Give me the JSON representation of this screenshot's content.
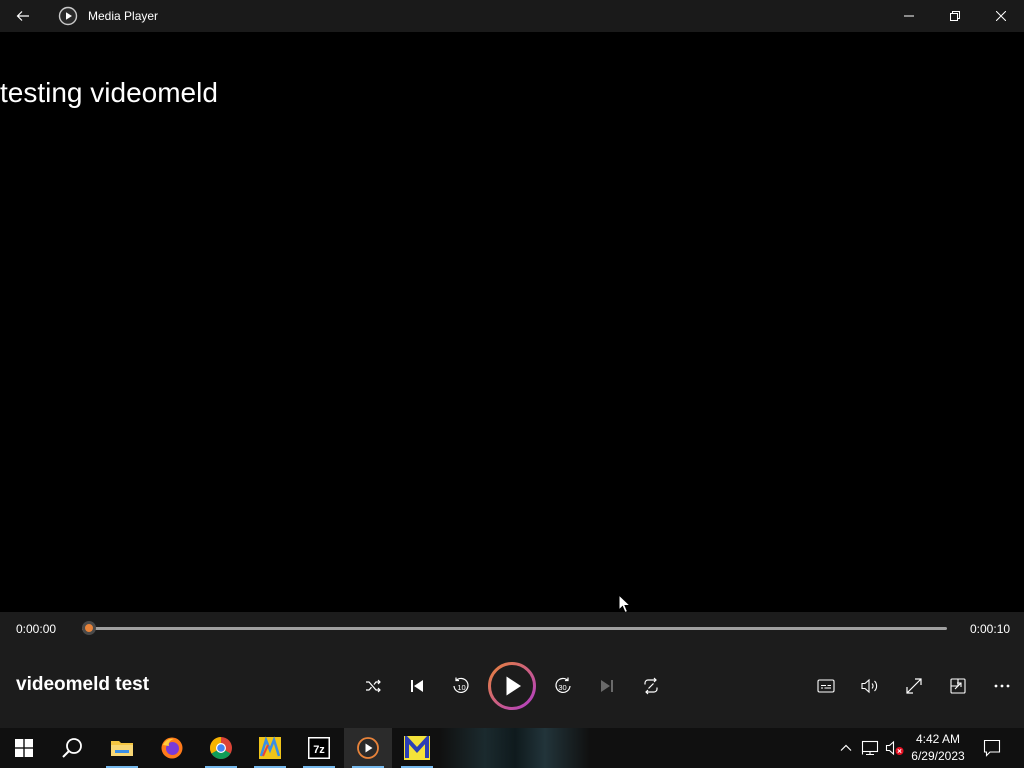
{
  "window": {
    "app_title": "Media Player"
  },
  "video": {
    "caption": "testing videomeld"
  },
  "playback": {
    "current_time": "0:00:00",
    "total_time": "0:00:10",
    "progress_fraction": 0.008,
    "media_title": "videomeld test",
    "rewind_label": "10",
    "forward_label": "30"
  },
  "taskbar": {
    "items": [
      "start",
      "search",
      "file-explorer",
      "firefox",
      "chrome",
      "app-m",
      "7zip",
      "media-player",
      "app-y"
    ],
    "time": "4:42 AM",
    "date": "6/29/2023"
  },
  "colors": {
    "accent": "#e8833a",
    "play_ring_start": "#e8833a",
    "play_ring_end": "#b03cc8",
    "taskbar_indicator": "#76b9ed"
  }
}
